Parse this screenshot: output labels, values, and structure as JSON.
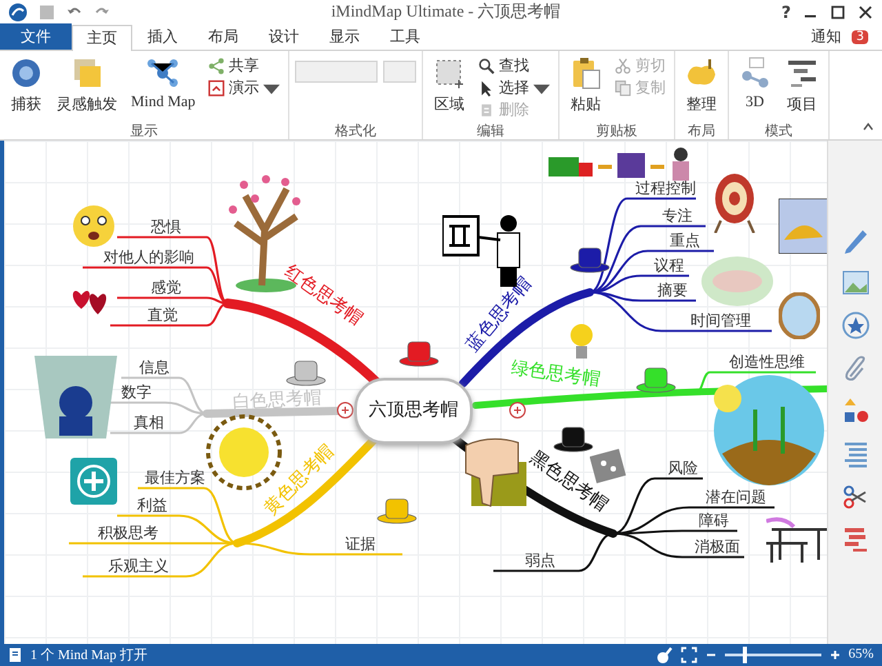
{
  "window": {
    "title": "iMindMap Ultimate - 六顶思考帽",
    "help": "?"
  },
  "tabs": [
    {
      "label": "文件",
      "kind": "file",
      "selected": false
    },
    {
      "label": "主页",
      "kind": "tab",
      "selected": true
    },
    {
      "label": "插入",
      "kind": "tab",
      "selected": false
    },
    {
      "label": "布局",
      "kind": "tab",
      "selected": false
    },
    {
      "label": "设计",
      "kind": "tab",
      "selected": false
    },
    {
      "label": "显示",
      "kind": "tab",
      "selected": false
    },
    {
      "label": "工具",
      "kind": "tab",
      "selected": false
    }
  ],
  "notifications": {
    "label": "通知",
    "count": "3"
  },
  "ribbon": [
    {
      "label": "显示",
      "items": [
        {
          "label": "捕获",
          "kind": "large",
          "disabled": false,
          "dropdown": false
        },
        {
          "label": "灵感触发",
          "kind": "large",
          "disabled": false,
          "dropdown": false
        },
        {
          "label": "Mind Map",
          "kind": "large",
          "disabled": false,
          "dropdown": false
        },
        {
          "label": "共享",
          "kind": "small",
          "disabled": false,
          "dropdown": false
        },
        {
          "label": "演示",
          "kind": "small",
          "disabled": false,
          "dropdown": true
        }
      ]
    },
    {
      "label": "格式化",
      "items": [
        {
          "kind": "combo",
          "disabled": true
        },
        {
          "kind": "combo",
          "disabled": true
        }
      ]
    },
    {
      "label": "编辑",
      "items": [
        {
          "label": "区域",
          "kind": "large",
          "disabled": false,
          "dropdown": false
        },
        {
          "label": "查找",
          "kind": "small",
          "disabled": false,
          "dropdown": false
        },
        {
          "label": "选择",
          "kind": "small",
          "disabled": false,
          "dropdown": true
        },
        {
          "label": "删除",
          "kind": "small",
          "disabled": true,
          "dropdown": false
        }
      ]
    },
    {
      "label": "剪贴板",
      "items": [
        {
          "label": "粘贴",
          "kind": "large",
          "disabled": false,
          "dropdown": false
        },
        {
          "label": "剪切",
          "kind": "small",
          "disabled": true,
          "dropdown": false
        },
        {
          "label": "复制",
          "kind": "small",
          "disabled": true,
          "dropdown": false
        }
      ]
    },
    {
      "label": "布局",
      "items": [
        {
          "label": "整理",
          "kind": "large",
          "disabled": false,
          "dropdown": false
        }
      ]
    },
    {
      "label": "模式",
      "items": [
        {
          "label": "3D",
          "kind": "large",
          "disabled": false,
          "dropdown": false
        },
        {
          "label": "项目",
          "kind": "large",
          "disabled": false,
          "dropdown": false
        }
      ]
    }
  ],
  "map": {
    "center": "六顶思考帽",
    "branches": [
      {
        "label": "红色思考帽",
        "color": "#e31b23",
        "topics": [
          "恐惧",
          "对他人的影响",
          "感觉",
          "直觉"
        ]
      },
      {
        "label": "白色思考帽",
        "color": "#c4c4c4",
        "topics": [
          "信息",
          "数字",
          "真相"
        ]
      },
      {
        "label": "黄色思考帽",
        "color": "#f2c200",
        "topics": [
          "最佳方案",
          "利益",
          "积极思考",
          "乐观主义",
          "证据"
        ]
      },
      {
        "label": "蓝色思考帽",
        "color": "#1c1ca8",
        "topics": [
          "过程控制",
          "专注",
          "重点",
          "议程",
          "摘要",
          "时间管理"
        ]
      },
      {
        "label": "绿色思考帽",
        "color": "#35e02a",
        "topics": [
          "创造性思维"
        ]
      },
      {
        "label": "黑色思考帽",
        "color": "#111111",
        "topics": [
          "风险",
          "潜在问题",
          "障碍",
          "消极面",
          "弱点"
        ]
      }
    ]
  },
  "status": {
    "text": "1 个 Mind Map 打开",
    "zoom": {
      "level": 0.2,
      "reading": "65%"
    }
  }
}
